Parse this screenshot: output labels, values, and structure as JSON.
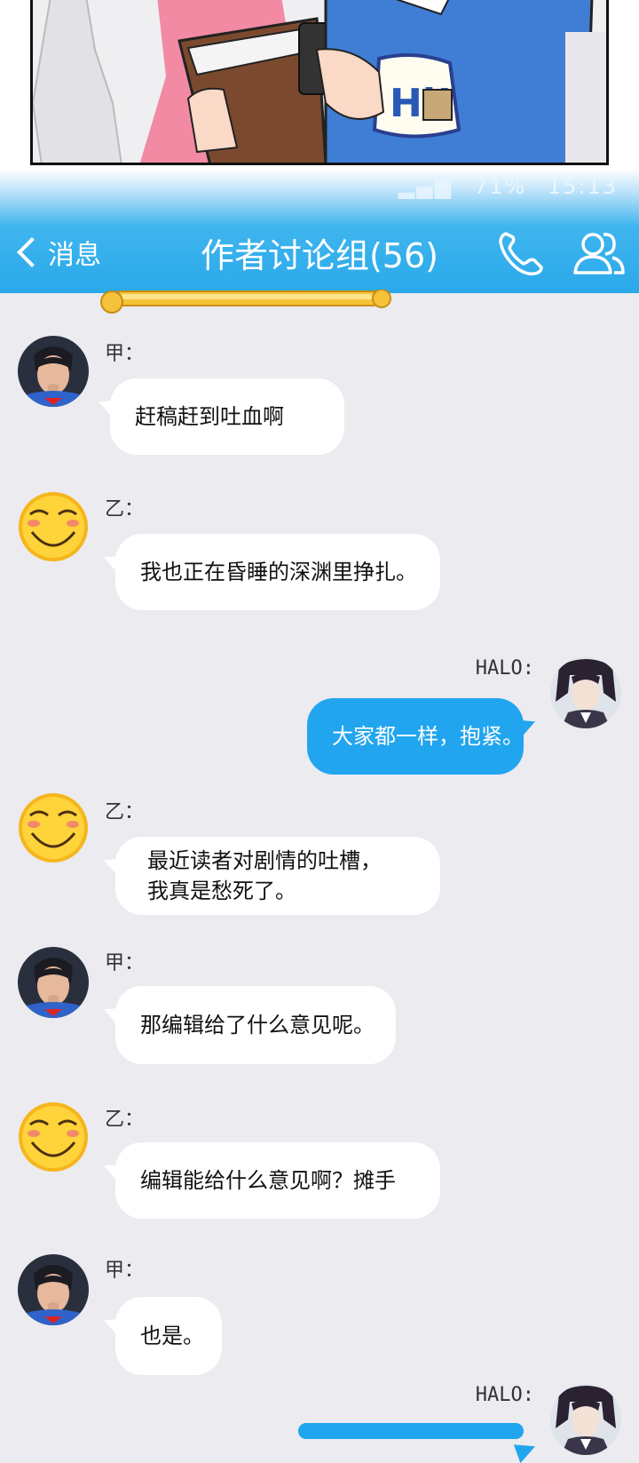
{
  "status_bar": {
    "time_text": "15:13",
    "battery_text": "71%"
  },
  "header": {
    "back_label": "消息",
    "title": "作者讨论组(56)",
    "call_icon": "phone-icon",
    "members_icon": "group-members-icon"
  },
  "colors": {
    "header_blue": "#2aa9ea",
    "chat_background": "#ebebf0",
    "outgoing_bubble": "#21a5ee",
    "incoming_bubble": "#ffffff"
  },
  "messages": [
    {
      "sender": "甲：",
      "side": "left",
      "avatar": "superman-avatar",
      "lines": [
        "赶稿赶到吐血啊"
      ]
    },
    {
      "sender": "乙：",
      "side": "left",
      "avatar": "smiley-avatar",
      "lines": [
        "我也正在昏睡的深渊里挣扎。"
      ]
    },
    {
      "sender": "HALO:",
      "side": "right",
      "avatar": "anime-man-avatar",
      "lines": [
        "大家都一样，抱紧。"
      ]
    },
    {
      "sender": "乙：",
      "side": "left",
      "avatar": "smiley-avatar",
      "lines": [
        "最近读者对剧情的吐槽，",
        "我真是愁死了。"
      ]
    },
    {
      "sender": "甲：",
      "side": "left",
      "avatar": "superman-avatar",
      "lines": [
        "那编辑给了什么意见呢。"
      ]
    },
    {
      "sender": "乙：",
      "side": "left",
      "avatar": "smiley-avatar",
      "lines": [
        "编辑能给什么意见啊？摊手"
      ]
    },
    {
      "sender": "甲：",
      "side": "left",
      "avatar": "superman-avatar",
      "lines": [
        "也是。"
      ]
    },
    {
      "sender": "HALO:",
      "side": "right",
      "avatar": "anime-man-avatar",
      "lines": []
    }
  ]
}
